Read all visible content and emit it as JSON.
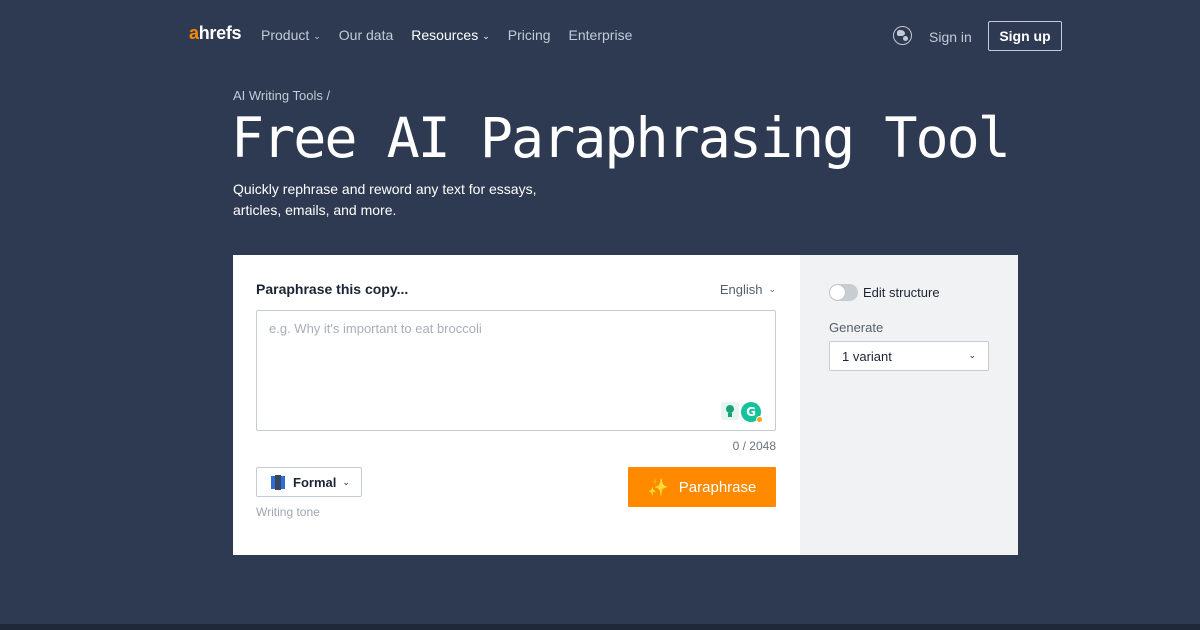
{
  "nav": {
    "logo_a": "a",
    "logo_rest": "hrefs",
    "links": [
      {
        "label": "Product",
        "has_dropdown": true
      },
      {
        "label": "Our data",
        "has_dropdown": false
      },
      {
        "label": "Resources",
        "has_dropdown": true
      },
      {
        "label": "Pricing",
        "has_dropdown": false
      },
      {
        "label": "Enterprise",
        "has_dropdown": false
      }
    ],
    "language_icon": "globe-icon",
    "signin_label": "Sign in",
    "signup_label": "Sign up"
  },
  "hero": {
    "breadcrumb": "AI Writing Tools /",
    "title": "Free AI Paraphrasing Tool",
    "subtitle_line1": "Quickly rephrase and reword any text for essays,",
    "subtitle_line2": "articles, emails, and more."
  },
  "tool": {
    "input_label": "Paraphrase this copy...",
    "language": "English",
    "placeholder": "e.g. Why it's important to eat broccoli",
    "counter": "0 / 2048",
    "tone_value": "Formal",
    "tone_caption": "Writing tone",
    "submit_label": "Paraphrase",
    "edit_structure_label": "Edit structure",
    "edit_structure_on": false,
    "generate_label": "Generate",
    "variant_value": "1 variant",
    "extension_icons": [
      "lightbulb-icon",
      "grammarly-icon"
    ]
  },
  "colors": {
    "background": "#2e3a51",
    "accent": "#ff8a00",
    "brand_a": "#ff8800"
  }
}
